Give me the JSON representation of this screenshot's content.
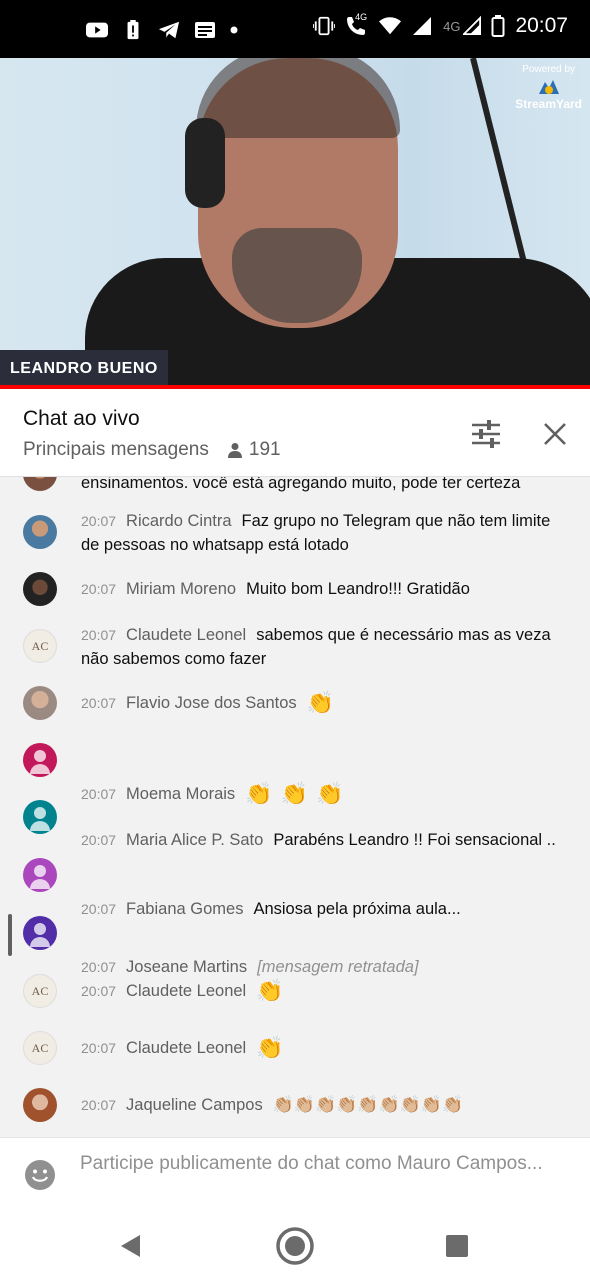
{
  "status_bar": {
    "time": "20:07",
    "left_icons": [
      "youtube-icon",
      "battery-alert-icon",
      "telegram-icon",
      "news-icon",
      "dot-icon"
    ],
    "right_icons": [
      "vibrate-icon",
      "volte-call-icon",
      "wifi-icon",
      "signal-icon",
      "signal-4g-icon",
      "battery-icon"
    ],
    "network_label_1": "4G",
    "network_label_2": "4G"
  },
  "video": {
    "presenter_name": "LEANDRO BUENO",
    "watermark_powered": "Powered by",
    "watermark_brand": "StreamYard",
    "progress_color": "#ff0000"
  },
  "chat_header": {
    "title": "Chat ao vivo",
    "mode": "Principais mensagens",
    "viewer_count": "191"
  },
  "messages": [
    {
      "time": "",
      "author": "",
      "text": "ensinamentos. você está agregando muito, pode ter certeza",
      "avatar": "photo"
    },
    {
      "time": "20:07",
      "author": "Ricardo Cintra",
      "text": "Faz grupo no Telegram que não tem limite de pessoas no whatsapp está lotado",
      "avatar": "photo"
    },
    {
      "time": "20:07",
      "author": "Miriam Moreno",
      "text": "Muito bom Leandro!!! Gratidão",
      "avatar": "photo"
    },
    {
      "time": "20:07",
      "author": "Claudete Leonel",
      "text": "sabemos que é necessário mas as veza não sabemos como fazer",
      "avatar": "AC"
    },
    {
      "time": "20:07",
      "author": "Flavio Jose dos Santos",
      "text": "",
      "emojis": [
        "👏"
      ],
      "avatar": "photo"
    },
    {
      "time": "20:07",
      "author": "Moema Morais",
      "text": "",
      "emojis": [
        "👏",
        "👏",
        "👏"
      ],
      "avatar": "default-pink"
    },
    {
      "time": "20:07",
      "author": "Maria Alice P. Sato",
      "text": "Parabéns Leandro !! Foi sensacional ..",
      "avatar": "default-teal"
    },
    {
      "time": "20:07",
      "author": "Fabiana Gomes",
      "text": "Ansiosa pela próxima aula...",
      "avatar": "default-purple"
    },
    {
      "time": "20:07",
      "author": "Joseane Martins",
      "text": "[mensagem retratada]",
      "avatar": "default-indigo"
    },
    {
      "time": "20:07",
      "author": "Claudete Leonel",
      "text": "",
      "emojis": [
        "👏"
      ],
      "avatar": "AC"
    },
    {
      "time": "20:07",
      "author": "Claudete Leonel",
      "text": "",
      "emojis": [
        "👏"
      ],
      "avatar": "AC"
    },
    {
      "time": "20:07",
      "author": "Jaqueline Campos",
      "text": "",
      "emojis_small": "👏🏼👏🏼👏🏼👏🏼👏🏼👏🏼👏🏼👏🏼👏🏼",
      "avatar": "photo"
    }
  ],
  "ac_logo": {
    "letters": "AC"
  },
  "input": {
    "placeholder": "Participe publicamente do chat como Mauro Campos..."
  },
  "colors": {
    "accent": "#ff0000",
    "chat_bg": "#f2f2f2",
    "author": "#606060",
    "timestamp": "#909090"
  }
}
